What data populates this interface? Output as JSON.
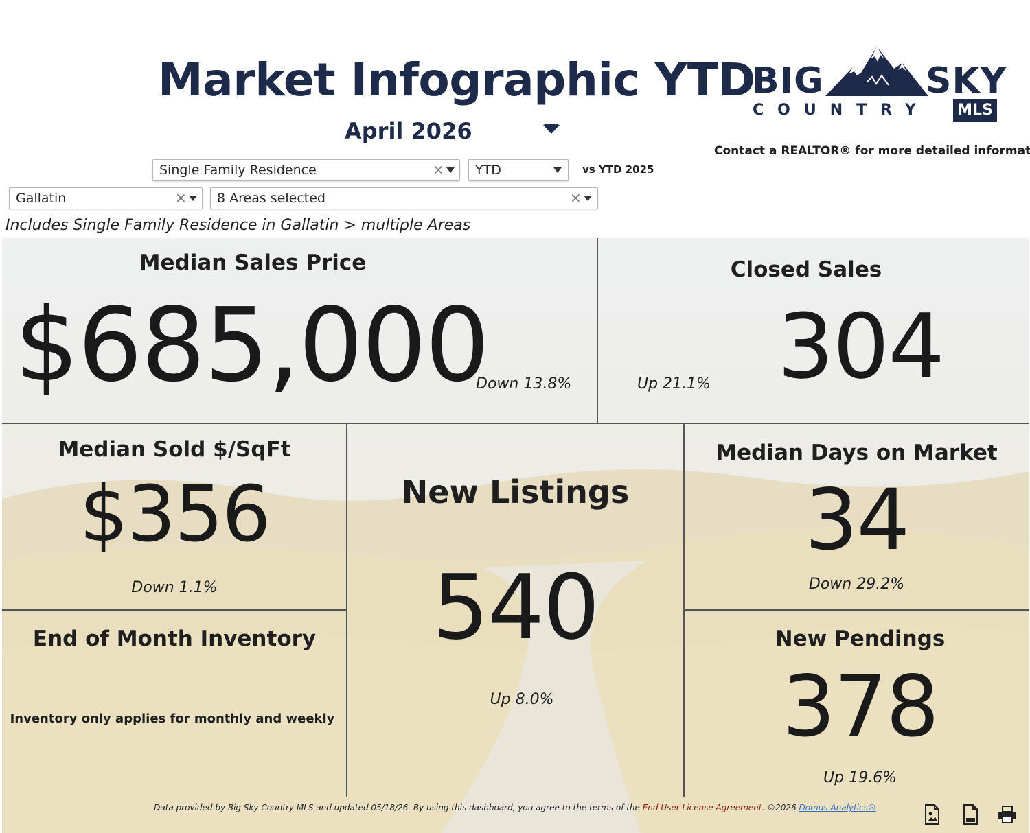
{
  "header": {
    "title": "Market Infographic YTD",
    "month": "April 2026",
    "contact_note": "Contact a REALTOR® for more detailed information."
  },
  "logo": {
    "big": "BIG",
    "sky": "SKY",
    "country": "COUNTRY",
    "mls": "MLS"
  },
  "filters": {
    "property_type": "Single Family Residence",
    "period": "YTD",
    "comparison": "vs YTD 2025",
    "county": "Gallatin",
    "areas": "8 Areas selected",
    "clear_glyph": "×"
  },
  "includes_note": "Includes Single Family Residence in Gallatin > multiple Areas",
  "tiles": {
    "median_sales_price": {
      "title": "Median Sales Price",
      "value": "$685,000",
      "change": "Down 13.8%"
    },
    "closed_sales": {
      "title": "Closed Sales",
      "value": "304",
      "change": "Up 21.1%"
    },
    "median_sold_sqft": {
      "title": "Median Sold $/SqFt",
      "value": "$356",
      "change": "Down 1.1%"
    },
    "new_listings": {
      "title": "New Listings",
      "value": "540",
      "change": "Up 8.0%"
    },
    "median_dom": {
      "title": "Median Days on Market",
      "value": "34",
      "change": "Down 29.2%"
    },
    "inventory": {
      "title": "End of Month Inventory",
      "note": "Inventory only applies for monthly and weekly"
    },
    "new_pendings": {
      "title": "New Pendings",
      "value": "378",
      "change": "Up 19.6%"
    }
  },
  "footer": {
    "text_before": "Data provided by Big Sky Country MLS and updated 05/18/26.  By using this dashboard, you agree to the terms of the ",
    "eula": "End User License Agreement",
    "text_mid": ".  ©2026 ",
    "domus": "Domus Analytics®"
  },
  "icons": {
    "image_export": "image-export-icon",
    "pdf_export": "pdf-export-icon",
    "print": "print-icon"
  },
  "colors": {
    "navy": "#1e2a4a",
    "eula_red": "#8b1a1a",
    "link_blue": "#3a6fbf",
    "divider": "#555555"
  }
}
